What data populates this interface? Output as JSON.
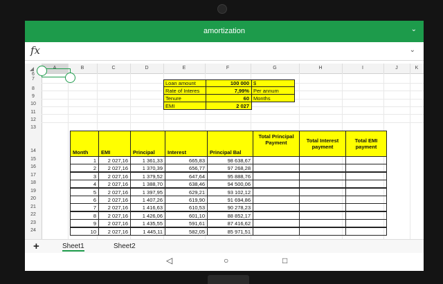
{
  "app": {
    "title": "amortization",
    "formula_icon": "fx",
    "collapse_icon": "chevron-down-icon"
  },
  "columns": [
    "A",
    "B",
    "C",
    "D",
    "E",
    "F",
    "G",
    "H",
    "I",
    "J",
    "K"
  ],
  "rows": [
    "6",
    "7",
    "8",
    "9",
    "10",
    "11",
    "12",
    "13",
    "14",
    "15",
    "16",
    "17",
    "18",
    "19",
    "20",
    "21",
    "22",
    "23",
    "24"
  ],
  "loan": {
    "amount_label": "Loan amount",
    "amount_value": "100 000",
    "amount_unit": "$",
    "rate_label": "Rate of Interes",
    "rate_value": "7,99%",
    "rate_unit": "Per annum",
    "tenure_label": "Tenure",
    "tenure_value": "60",
    "tenure_unit": "Months",
    "emi_label": "EMI",
    "emi_value": "2 027"
  },
  "table": {
    "headers": {
      "month": "Month",
      "emi": "EMI",
      "principal": "Principal",
      "interest": "Interest",
      "principal_bal": "Principal Bal",
      "total_principal": "Total Principal Payment",
      "total_interest": "Total Interest payment",
      "total_emi": "Total EMI payment"
    },
    "rows": [
      {
        "month": "1",
        "emi": "2 027,16",
        "principal": "1 361,33",
        "interest": "665,83",
        "bal": "98 638,67"
      },
      {
        "month": "2",
        "emi": "2 027,16",
        "principal": "1 370,39",
        "interest": "656,77",
        "bal": "97 268,28"
      },
      {
        "month": "3",
        "emi": "2 027,16",
        "principal": "1 379,52",
        "interest": "647,64",
        "bal": "95 888,76"
      },
      {
        "month": "4",
        "emi": "2 027,16",
        "principal": "1 388,70",
        "interest": "638,46",
        "bal": "94 500,06"
      },
      {
        "month": "5",
        "emi": "2 027,16",
        "principal": "1 397,95",
        "interest": "629,21",
        "bal": "93 102,12"
      },
      {
        "month": "6",
        "emi": "2 027,16",
        "principal": "1 407,26",
        "interest": "619,90",
        "bal": "91 694,86"
      },
      {
        "month": "7",
        "emi": "2 027,16",
        "principal": "1 416,63",
        "interest": "610,53",
        "bal": "90 278,23"
      },
      {
        "month": "8",
        "emi": "2 027,16",
        "principal": "1 426,06",
        "interest": "601,10",
        "bal": "88 852,17"
      },
      {
        "month": "9",
        "emi": "2 027,16",
        "principal": "1 435,55",
        "interest": "591,61",
        "bal": "87 416,62"
      },
      {
        "month": "10",
        "emi": "2 027,16",
        "principal": "1 445,11",
        "interest": "582,05",
        "bal": "85 971,51"
      }
    ]
  },
  "sheets": {
    "add_label": "+",
    "tab1": "Sheet1",
    "tab2": "Sheet2"
  },
  "nav": {
    "back": "◁",
    "home": "○",
    "recent": "□"
  },
  "colors": {
    "accent": "#1d9b4b",
    "highlight": "#ffff00"
  }
}
